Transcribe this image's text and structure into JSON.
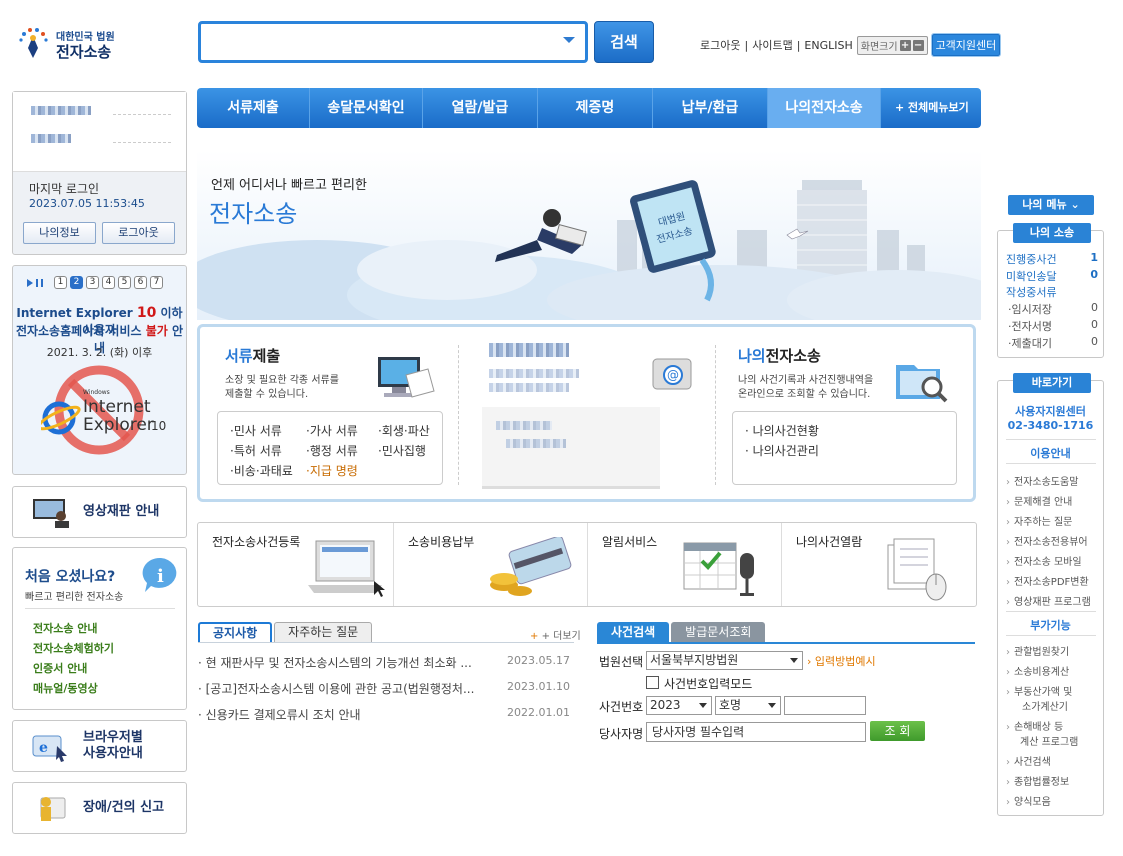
{
  "header": {
    "logo_line1": "대한민국 법원",
    "logo_line2": "전자소송",
    "search_placeholder": "",
    "search_button": "검색",
    "links": [
      "로그아웃",
      "사이트맵",
      "ENGLISH"
    ],
    "font_size_label": "화면크기",
    "font_plus": "+",
    "font_minus": "−",
    "support_center": "고객지원센터"
  },
  "nav": {
    "items": [
      "서류제출",
      "송달문서확인",
      "열람/발급",
      "제증명",
      "납부/환급",
      "나의전자소송"
    ],
    "all_menu": "+ 전체메뉴보기",
    "active_index": 5
  },
  "login": {
    "last_login_label": "마지막 로그인",
    "last_login_time": "2023.07.05 11:53:45",
    "my_info": "나의정보",
    "logout": "로그아웃"
  },
  "ie_notice": {
    "pages": [
      "1",
      "2",
      "3",
      "4",
      "5",
      "6",
      "7"
    ],
    "active_page": 2,
    "line1_a": "Internet Explorer ",
    "line1_b": "10",
    "line1_c": " 이하 사용자",
    "line2_a": "전자소송홈페이지 서비스 ",
    "line2_b": "불가",
    "line2_c": " 안내",
    "date": "2021. 3. 2. (화) 이후",
    "logo_small": "Windows",
    "logo_line1": "Internet",
    "logo_line2": "Explorer",
    "logo_ver": "10"
  },
  "video_trial": "영상재판 안내",
  "first_visit": {
    "title": "처음 오셨나요?",
    "subtitle": "빠르고 편리한 전자소송",
    "links": [
      "전자소송 안내",
      "전자소송체험하기",
      "인증서 안내",
      "매뉴얼/동영상"
    ]
  },
  "browser_guide": {
    "line1": "브라우저별",
    "line2": "사용자안내"
  },
  "error_report": "장애/건의 신고",
  "hero": {
    "tagline": "언제 어디서나 빠르고 편리한",
    "title": "전자소송",
    "monitor_text1": "대법원",
    "monitor_text2": "전자소송"
  },
  "services": {
    "submit": {
      "title_a": "서류",
      "title_b": "제출",
      "desc1": "소장 및 필요한 각종 서류를",
      "desc2": "제출할 수 있습니다.",
      "items": [
        "·민사 서류",
        "·가사 서류",
        "·회생·파산",
        "·특허 서류",
        "·행정 서류",
        "·민사집행",
        "·비송·과태료",
        "·지급 명령"
      ],
      "highlight_color": "#c76a00"
    },
    "my": {
      "title_a": "나의",
      "title_b": "전자소송",
      "desc1": "나의 사건기록과 사건진행내역을",
      "desc2": "온라인으로 조회할 수 있습니다.",
      "items": [
        "· 나의사건현황",
        "· 나의사건관리"
      ]
    }
  },
  "quick": [
    "전자소송사건등록",
    "소송비용납부",
    "알림서비스",
    "나의사건열람"
  ],
  "notice": {
    "tabs": [
      "공지사항",
      "자주하는 질문"
    ],
    "more": "+ 더보기",
    "rows": [
      {
        "title": "· 현 재판사무 및 전자소송시스템의 기능개선 최소화 ...",
        "date": "2023.05.17"
      },
      {
        "title": "· [공고]전자소송시스템 이용에 관한 공고(법원행정처...",
        "date": "2023.01.10"
      },
      {
        "title": "· 신용카드 결제오류시 조치 안내",
        "date": "2022.01.01"
      }
    ]
  },
  "case_search": {
    "tabs": [
      "사건검색",
      "발급문서조회"
    ],
    "court_label": "법원선택",
    "court_value": "서울북부지방법원",
    "input_example": "입력방법예시",
    "number_mode": "사건번호입력모드",
    "case_no_label": "사건번호",
    "year_value": "2023",
    "type_value": "호명",
    "party_label": "당사자명",
    "party_placeholder": "당사자명 필수입력",
    "search_button": "조 회"
  },
  "right": {
    "my_menu": "나의 메뉴",
    "my_lawsuit": "나의 소송",
    "stats": [
      {
        "label": "진행중사건",
        "value": "1",
        "link": true
      },
      {
        "label": "미확인송달",
        "value": "0",
        "link": true
      },
      {
        "label": "작성중서류",
        "value": "",
        "link": true
      },
      {
        "label": "·임시저장",
        "value": "0",
        "link": false
      },
      {
        "label": "·전자서명",
        "value": "0",
        "link": false
      },
      {
        "label": "·제출대기",
        "value": "0",
        "link": false
      }
    ],
    "shortcut": "바로가기",
    "help_center": "사용자지원센터",
    "phone": "02-3480-1716",
    "usage_title": "이용안내",
    "usage": [
      "전자소송도움말",
      "문제해결 안내",
      "자주하는 질문",
      "전자소송전용뷰어",
      "전자소송 모바일",
      "전자소송PDF변환",
      "영상재판 프로그램"
    ],
    "extra_title": "부가기능",
    "extra": [
      "관할법원찾기",
      "소송비용계산",
      "부동산가액 및",
      "소가계산기",
      "손해배상 등",
      "계산 프로그램",
      "사건검색",
      "종합법률정보",
      "양식모음"
    ]
  },
  "colors": {
    "brand_blue": "#2a83d6",
    "accent_orange": "#e07800",
    "alert_red": "#d01818"
  }
}
